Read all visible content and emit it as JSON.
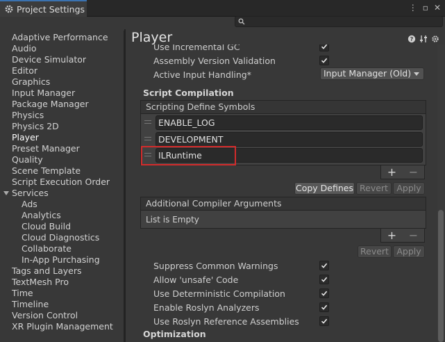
{
  "window": {
    "tab_title": "Project Settings",
    "icon": "gear-icon",
    "controls": [
      "kebab-menu-icon",
      "maximize-icon",
      "close-icon"
    ]
  },
  "search": {
    "placeholder": "",
    "value": "",
    "icon": "search-icon"
  },
  "sidebar": {
    "items": [
      {
        "label": "Adaptive Performance"
      },
      {
        "label": "Audio"
      },
      {
        "label": "Device Simulator"
      },
      {
        "label": "Editor"
      },
      {
        "label": "Graphics"
      },
      {
        "label": "Input Manager"
      },
      {
        "label": "Package Manager"
      },
      {
        "label": "Physics"
      },
      {
        "label": "Physics 2D"
      },
      {
        "label": "Player",
        "selected": true
      },
      {
        "label": "Preset Manager"
      },
      {
        "label": "Quality"
      },
      {
        "label": "Scene Template"
      },
      {
        "label": "Script Execution Order"
      },
      {
        "label": "Services",
        "expanded": true
      },
      {
        "label": "Ads",
        "child": true
      },
      {
        "label": "Analytics",
        "child": true
      },
      {
        "label": "Cloud Build",
        "child": true
      },
      {
        "label": "Cloud Diagnostics",
        "child": true
      },
      {
        "label": "Collaborate",
        "child": true
      },
      {
        "label": "In-App Purchasing",
        "child": true
      },
      {
        "label": "Tags and Layers"
      },
      {
        "label": "TextMesh Pro"
      },
      {
        "label": "Time"
      },
      {
        "label": "Timeline"
      },
      {
        "label": "Version Control"
      },
      {
        "label": "XR Plugin Management"
      }
    ]
  },
  "main": {
    "title": "Player",
    "header_icons": [
      "help-icon",
      "preset-icon",
      "settings-icon"
    ],
    "top_rows": [
      {
        "label": "Use Incremental GC",
        "checked": true
      },
      {
        "label": "Assembly Version Validation",
        "checked": true
      }
    ],
    "active_input": {
      "label": "Active Input Handling*",
      "value": "Input Manager (Old)"
    },
    "script_compilation": {
      "title": "Script Compilation",
      "define_symbols_header": "Scripting Define Symbols",
      "symbols": [
        "ENABLE_LOG",
        "DEVELOPMENT",
        "ILRuntime"
      ],
      "plus": "+",
      "minus": "−",
      "copy_defines": "Copy Defines",
      "revert": "Revert",
      "apply": "Apply"
    },
    "compiler_args": {
      "header": "Additional Compiler Arguments",
      "empty_text": "List is Empty",
      "plus": "+",
      "minus": "−",
      "revert": "Revert",
      "apply": "Apply"
    },
    "options": [
      {
        "label": "Suppress Common Warnings",
        "checked": true
      },
      {
        "label": "Allow 'unsafe' Code",
        "checked": true
      },
      {
        "label": "Use Deterministic Compilation",
        "checked": true
      },
      {
        "label": "Enable Roslyn Analyzers",
        "checked": true
      },
      {
        "label": "Use Roslyn Reference Assemblies",
        "checked": true
      }
    ],
    "optimization_title": "Optimization"
  },
  "colors": {
    "highlight": "#d42b2b",
    "accent": "#3a72b0"
  }
}
